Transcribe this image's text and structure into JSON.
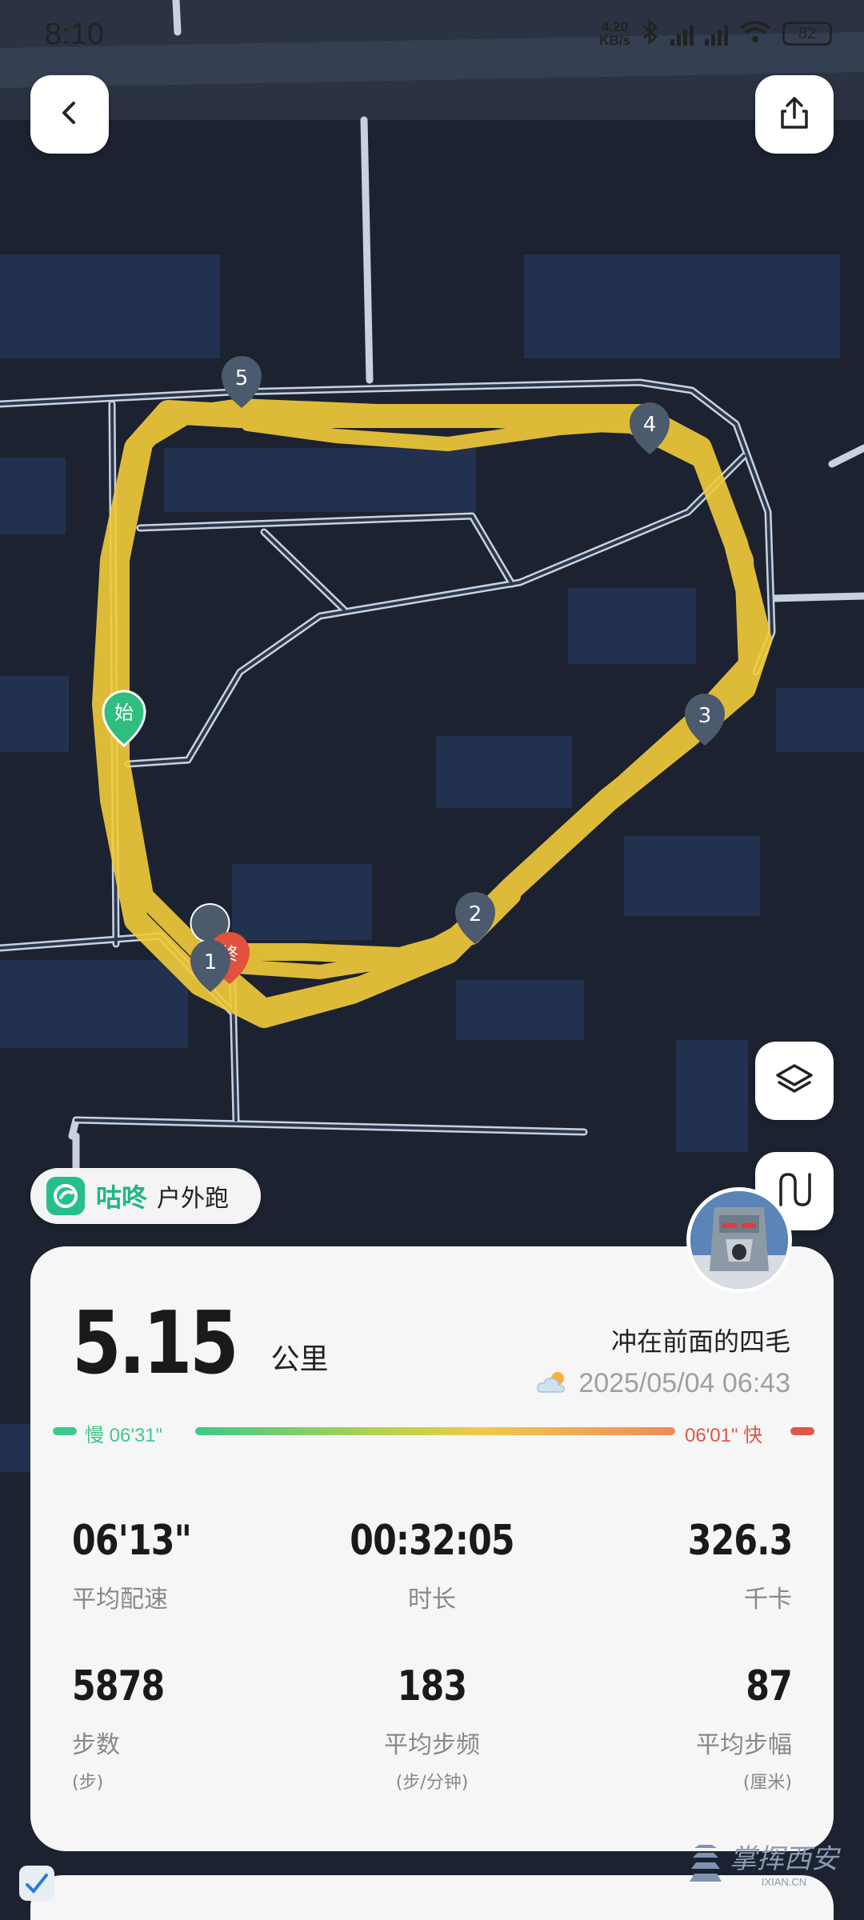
{
  "status_bar": {
    "time": "8:10",
    "net_speed": "4.20",
    "net_speed_unit": "KB/s",
    "battery": "82"
  },
  "map": {
    "km_markers": [
      "1",
      "2",
      "3",
      "4",
      "5"
    ],
    "start_label": "始",
    "end_label": "终",
    "route_color": "#f2cc3a",
    "map_bg": "#1c2230"
  },
  "brand": {
    "name": "咕咚",
    "activity": "户外跑"
  },
  "summary": {
    "distance": "5.15",
    "distance_unit": "公里",
    "runner_name": "冲在前面的四毛",
    "date": "2025/05/04 06:43",
    "weather_icon": "partly-cloudy-icon",
    "pace_slow_label": "慢 06'31\"",
    "pace_fast_label": "06'01\" 快"
  },
  "stats": [
    {
      "value": "06'13\"",
      "label": "平均配速",
      "unit": ""
    },
    {
      "value": "00:32:05",
      "label": "时长",
      "unit": ""
    },
    {
      "value": "326.3",
      "label": "千卡",
      "unit": ""
    },
    {
      "value": "5878",
      "label": "步数",
      "unit": "(步)"
    },
    {
      "value": "183",
      "label": "平均步频",
      "unit": "(步/分钟)"
    },
    {
      "value": "87",
      "label": "平均步幅",
      "unit": "(厘米)"
    }
  ],
  "watermark": {
    "text": "掌挥西安",
    "sub": "IXIAN.CN"
  }
}
